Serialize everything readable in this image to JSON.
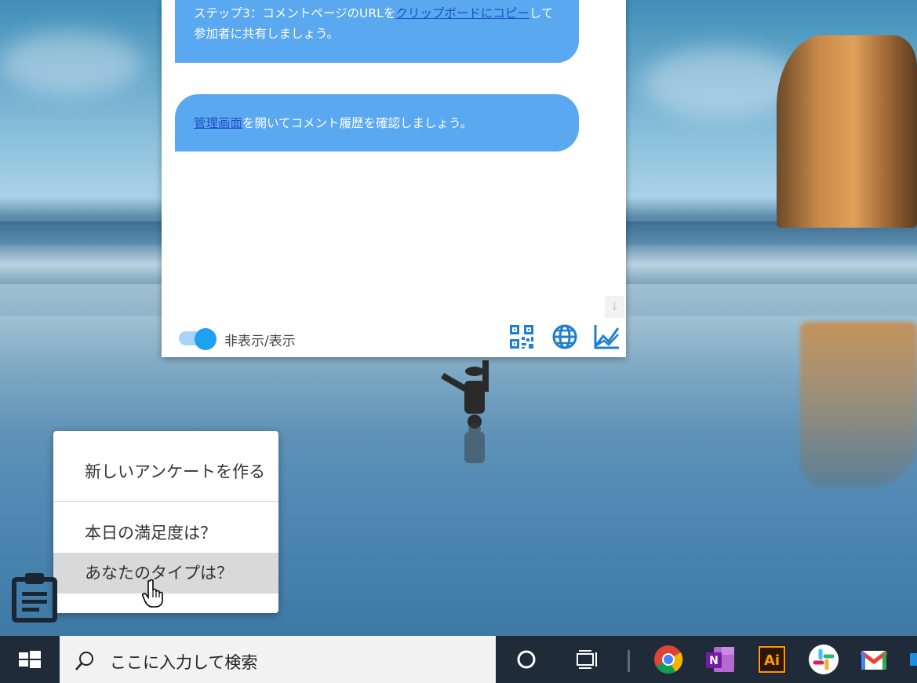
{
  "panel": {
    "bubble1_before": "ステップ3：コメントページのURLを",
    "bubble1_link": "クリップボードにコピー",
    "bubble1_after": "して参加者に共有しましょう。",
    "bubble2_link": "管理画面",
    "bubble2_after": "を開いてコメント履歴を確認しましょう。",
    "scroll_down_glyph": "↓",
    "toggle_label": "非表示/表示",
    "toggle_on": true,
    "tools": [
      "qr-code-icon",
      "globe-icon",
      "chart-icon"
    ]
  },
  "popup_menu": {
    "items": [
      {
        "label": "新しいアンケートを作る"
      },
      {
        "label": "本日の満足度は？"
      },
      {
        "label": "あなたのタイプは？",
        "hovered": true
      }
    ]
  },
  "taskbar": {
    "search_placeholder": "ここに入力して検索",
    "apps": [
      "cortana-icon",
      "task-view-icon",
      "chrome-icon",
      "onenote-icon",
      "illustrator-icon",
      "slack-icon",
      "gmail-icon"
    ],
    "illustrator_label": "Ai",
    "onenote_label": "N"
  },
  "colors": {
    "bubble": "#5aa8f0",
    "link": "#1f4fc7",
    "accent": "#1ea1f2",
    "taskbar": "#1f2b39"
  }
}
